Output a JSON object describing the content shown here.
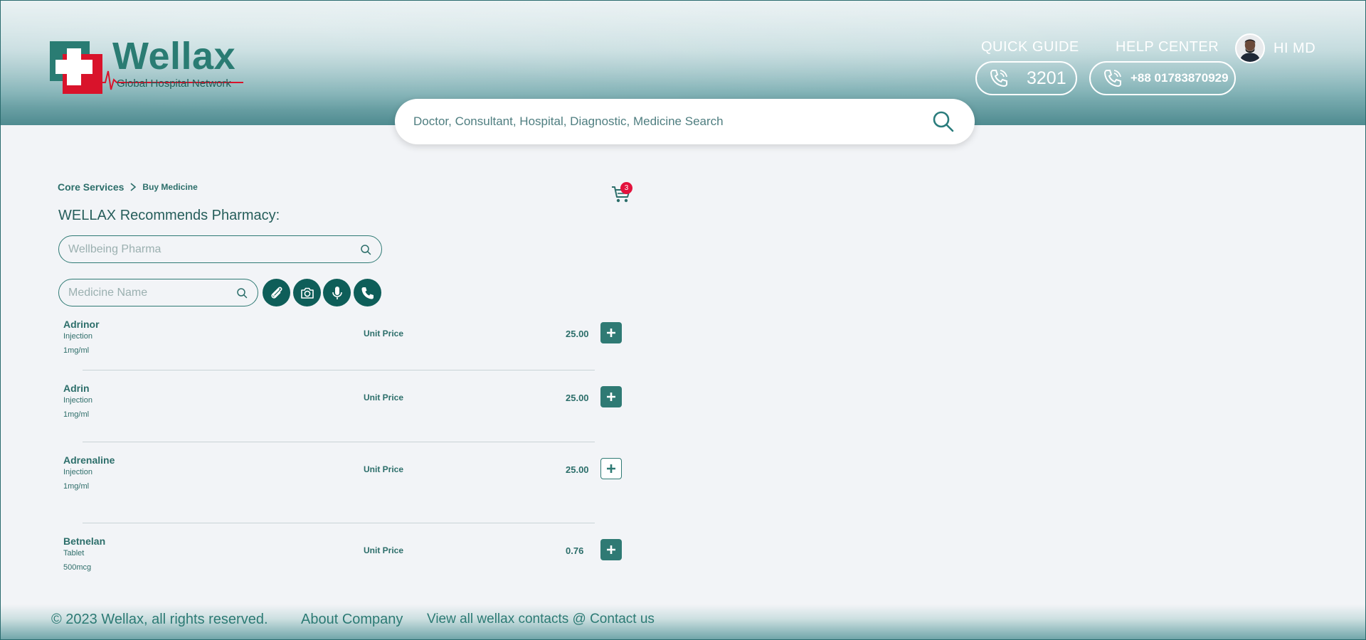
{
  "colors": {
    "brand_teal": "#2f7a74",
    "dark_teal": "#0e5e59",
    "badge_red": "#e3123d",
    "logo_red": "#d9132b",
    "background": "#f2f4f7"
  },
  "header": {
    "logo": {
      "word": "Wellax",
      "tagline": "Global Hospital Network",
      "icon": "medical-cross-icon"
    },
    "quick_guide": {
      "label": "QUICK GUIDE",
      "phone": "3201",
      "icon": "phone-icon"
    },
    "help_center": {
      "label": "HELP CENTER",
      "phone": "+88 01783870929",
      "icon": "phone-icon"
    },
    "user": {
      "greeting": "HI MD",
      "icon": "avatar"
    }
  },
  "search": {
    "placeholder": "Doctor, Consultant, Hospital, Diagnostic, Medicine Search",
    "icon": "search-icon"
  },
  "breadcrumb": {
    "items": [
      "Core Services",
      "Buy Medicine"
    ]
  },
  "cart": {
    "count": "3",
    "icon": "cart-icon"
  },
  "main": {
    "title": "WELLAX Recommends Pharmacy:",
    "pharmacy_placeholder": "Wellbeing Pharma",
    "medicine_placeholder": "Medicine Name",
    "tools": [
      "attach-icon",
      "camera-icon",
      "microphone-icon",
      "phone-icon"
    ]
  },
  "medicines": [
    {
      "name": "Adrinor",
      "type": "Injection",
      "dose": "1mg/ml",
      "unit_label": "Unit Price",
      "price": "25.00"
    },
    {
      "name": "Adrin",
      "type": "Injection",
      "dose": "1mg/ml",
      "unit_label": "Unit Price",
      "price": "25.00"
    },
    {
      "name": "Adrenaline",
      "type": "Injection",
      "dose": "1mg/ml",
      "unit_label": "Unit Price",
      "price": "25.00"
    },
    {
      "name": "Betnelan",
      "type": "Tablet",
      "dose": "500mcg",
      "unit_label": "Unit Price",
      "price": "0.76"
    }
  ],
  "footer": {
    "copyright": "© 2023 Wellax, all rights reserved.",
    "about": "About Company",
    "contacts": "View all wellax contacts @ Contact us"
  }
}
